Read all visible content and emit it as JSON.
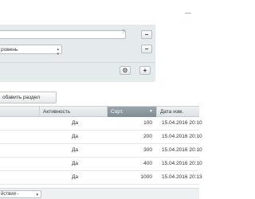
{
  "filter": {
    "search_value": "",
    "help_icon_glyph": "?",
    "section_select_value": "ровень",
    "remove_glyph": "−",
    "settings_glyph": "⚙",
    "add_glyph": "+"
  },
  "toolbar": {
    "add_section_label": "обавить раздел"
  },
  "table": {
    "columns": [
      {
        "label": ""
      },
      {
        "label": "Активность"
      },
      {
        "label": "Сорт."
      },
      {
        "label": "Дата изм."
      }
    ],
    "sort_indicator": "▼",
    "rows": [
      {
        "active": "Да",
        "sort": "100",
        "date": "15.04.2016 20:10"
      },
      {
        "active": "Да",
        "sort": "200",
        "date": "15.04.2016 20:10"
      },
      {
        "active": "Да",
        "sort": "300",
        "date": "15.04.2016 20:10"
      },
      {
        "active": "Да",
        "sort": "400",
        "date": "15.04.2016 20:10"
      },
      {
        "active": "Да",
        "sort": "1000",
        "date": "15.04.2016 20:13"
      }
    ]
  },
  "footer": {
    "action_select_value": "йствия -"
  }
}
